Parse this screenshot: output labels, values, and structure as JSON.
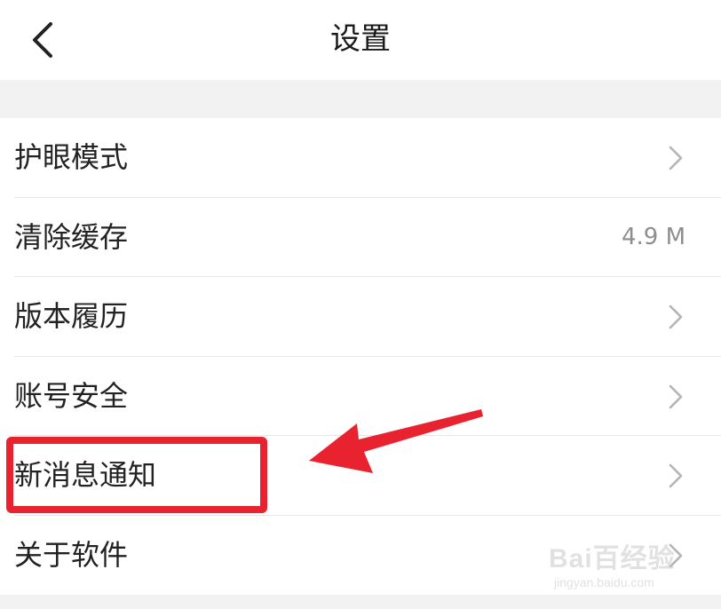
{
  "header": {
    "title": "设置",
    "back_icon": "chevron-left-icon"
  },
  "settings": {
    "items": [
      {
        "label": "护眼模式",
        "trailing": "chevron"
      },
      {
        "label": "清除缓存",
        "value": "4.9 M"
      },
      {
        "label": "版本履历",
        "trailing": "chevron"
      },
      {
        "label": "账号安全",
        "trailing": "chevron"
      },
      {
        "label": "新消息通知",
        "trailing": "chevron"
      },
      {
        "label": "关于软件",
        "trailing": "chevron"
      }
    ]
  },
  "annotation": {
    "color": "#e8222e",
    "highlighted_item": "新消息通知"
  },
  "watermark": {
    "brand": "Bai百经验",
    "site": "jingyan.baidu.com"
  }
}
